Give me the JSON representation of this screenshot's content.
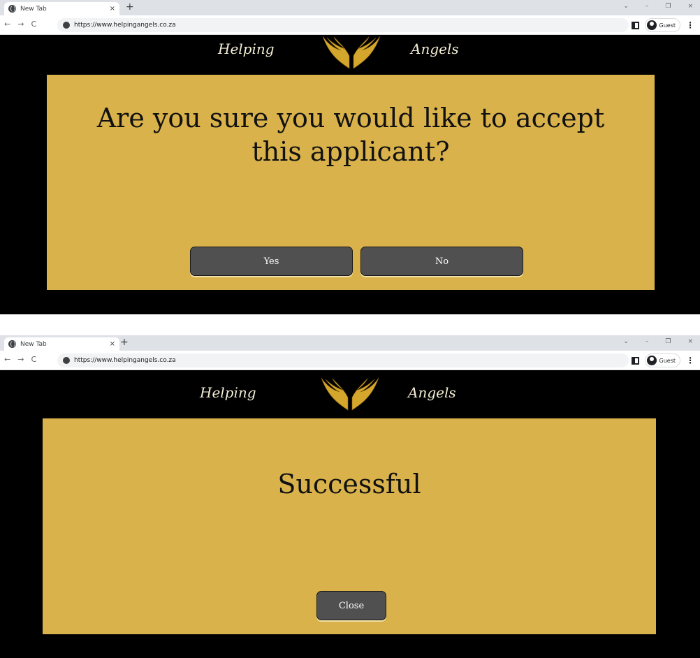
{
  "browser": {
    "tab_title": "New Tab",
    "tab_close": "×",
    "new_tab": "+",
    "url": "https://www.helpingangels.co.za",
    "profile_label": "Guest",
    "back": "←",
    "forward": "→",
    "reload": "C",
    "minimize": "–",
    "restore": "❐",
    "close_window": "×",
    "tab_search": "⌄",
    "menu": "⋮"
  },
  "header": {
    "left_word": "Helping",
    "right_word": "Angels",
    "logo": "gold-wings-icon"
  },
  "dialog_confirm": {
    "message": "Are you sure you would like to accept this applicant?",
    "yes_label": "Yes",
    "no_label": "No"
  },
  "dialog_success": {
    "message": "Successful",
    "close_label": "Close"
  },
  "colors": {
    "modal_bg": "#d9b24b",
    "button_bg": "#505050",
    "page_bg": "#000000",
    "brand_text": "#f4eed6"
  }
}
